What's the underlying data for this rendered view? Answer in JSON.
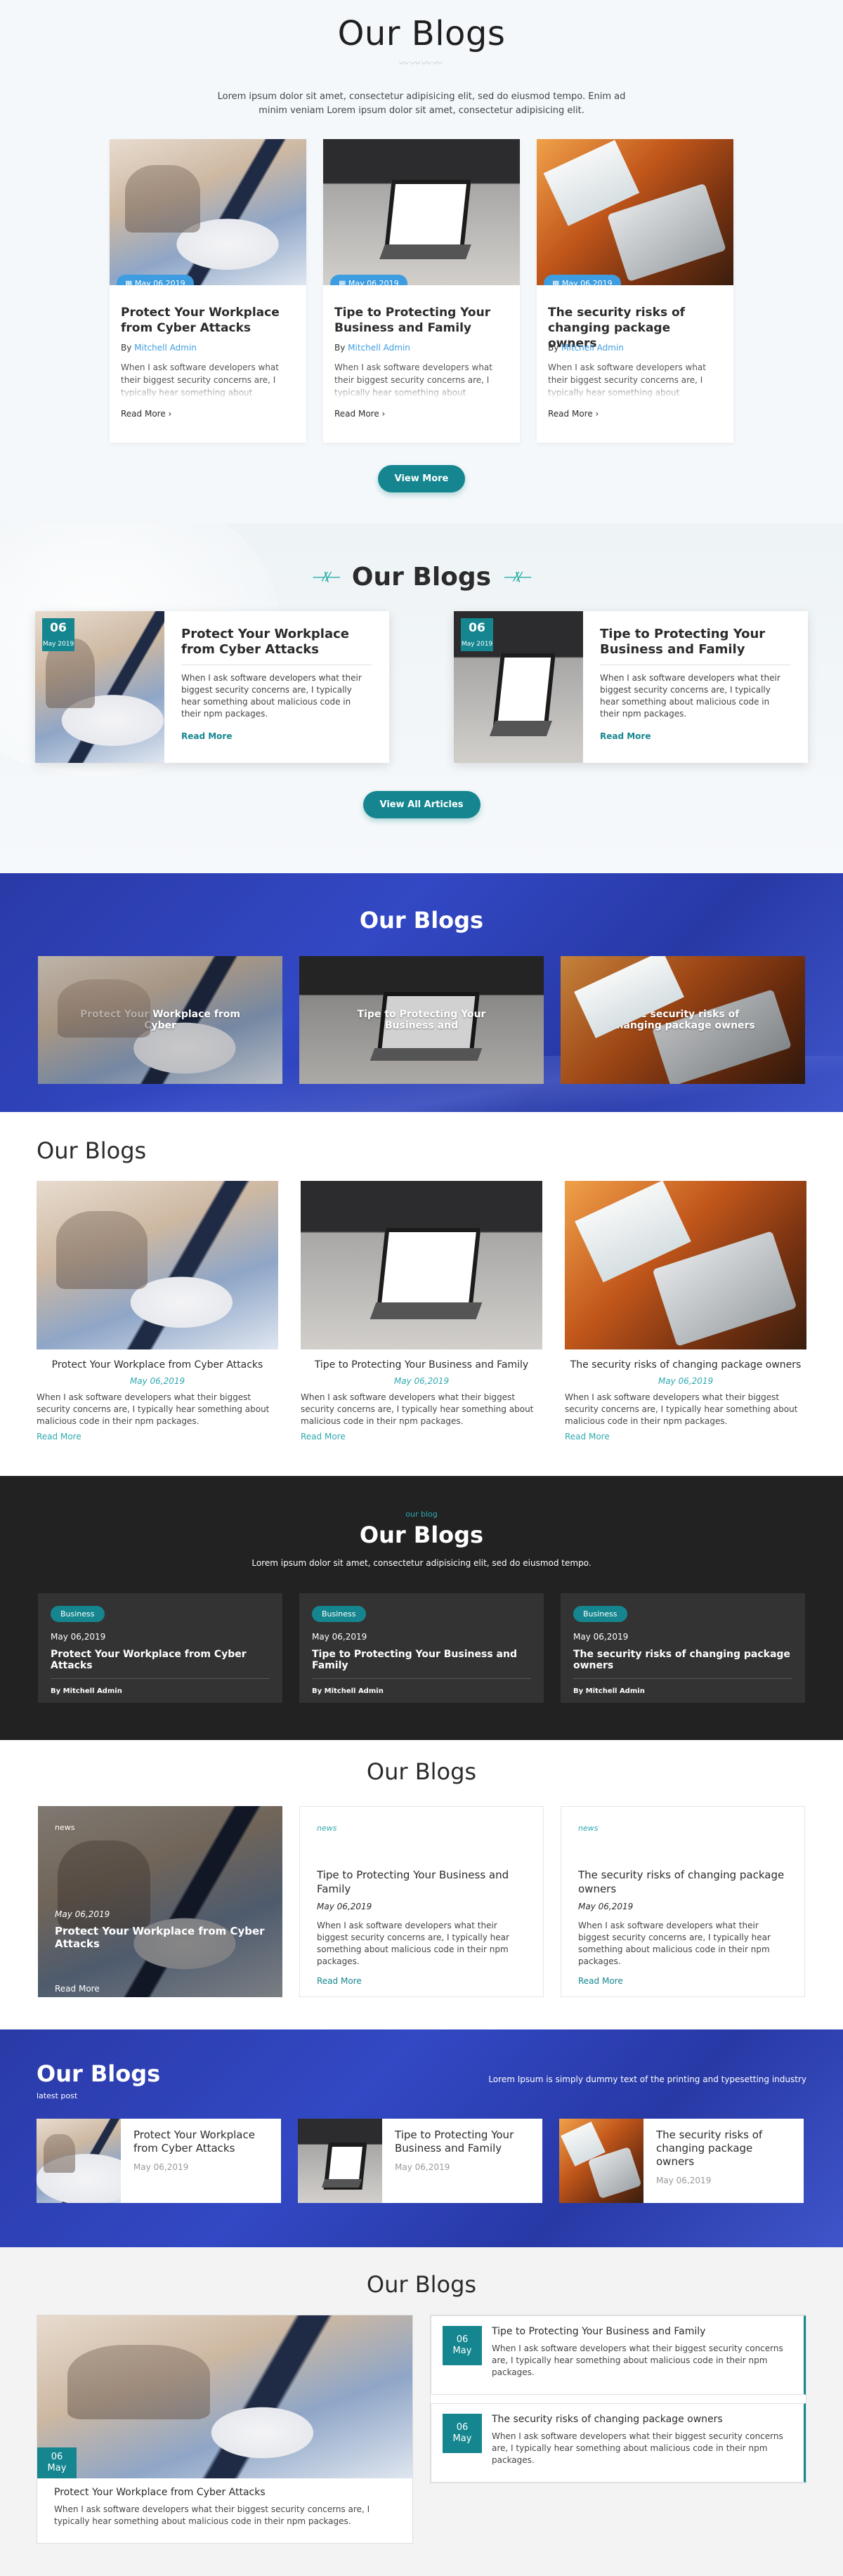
{
  "s1": {
    "title": "Our Blogs",
    "intro": "Lorem ipsum dolor sit amet, consectetur adipisicing elit, sed do eiusmod tempo. Enim ad minim veniam Lorem ipsum dolor sit amet, consectetur adipisicing elit.",
    "cards": [
      {
        "date": "May 06,2019",
        "title": "Protect Your Workplace from Cyber Attacks",
        "by": "By",
        "author": "Mitchell Admin",
        "excerpt": "When I ask software developers what their biggest security concerns are, I typically hear something about",
        "readmore": "Read More"
      },
      {
        "date": "May 06,2019",
        "title": "Tipe to Protecting Your Business and Family",
        "by": "By",
        "author": "Mitchell Admin",
        "excerpt": "When I ask software developers what their biggest security concerns are, I typically hear something about",
        "readmore": "Read More"
      },
      {
        "date": "May 06,2019",
        "title": "The security risks of changing package owners",
        "by": "By",
        "author": "Mitchell Admin",
        "excerpt": "When I ask software developers what their biggest security concerns are, I typically hear something about",
        "readmore": "Read More"
      }
    ],
    "button": "View More"
  },
  "s2": {
    "title": "Our Blogs",
    "cards": [
      {
        "day": "06",
        "month": "May 2019",
        "title": "Protect Your Workplace from Cyber Attacks",
        "excerpt": "When I ask software developers what their biggest security concerns are, I typically hear something about malicious code in their npm packages.",
        "readmore": "Read More"
      },
      {
        "day": "06",
        "month": "May 2019",
        "title": "Tipe to Protecting Your Business and Family",
        "excerpt": "When I ask software developers what their biggest security concerns are, I typically hear something about malicious code in their npm packages.",
        "readmore": "Read More"
      }
    ],
    "button": "View All Articles"
  },
  "s3": {
    "title": "Our Blogs",
    "tiles": [
      {
        "title": "Protect Your Workplace from Cyber"
      },
      {
        "title": "Tipe to Protecting Your Business and"
      },
      {
        "title": "The security risks of changing package owners"
      }
    ]
  },
  "s4": {
    "title": "Our Blogs",
    "cards": [
      {
        "title": "Protect Your Workplace from Cyber Attacks",
        "date": "May 06,2019",
        "excerpt": "When I ask software developers what their biggest security concerns are, I typically hear something about malicious code in their npm packages.",
        "readmore": "Read More"
      },
      {
        "title": "Tipe to Protecting Your Business and Family",
        "date": "May 06,2019",
        "excerpt": "When I ask software developers what their biggest security concerns are, I typically hear something about malicious code in their npm packages.",
        "readmore": "Read More"
      },
      {
        "title": "The security risks of changing package owners",
        "date": "May 06,2019",
        "excerpt": "When I ask software developers what their biggest security concerns are, I typically hear something about malicious code in their npm packages.",
        "readmore": "Read More"
      }
    ]
  },
  "s5": {
    "kicker": "our blog",
    "title": "Our Blogs",
    "intro": "Lorem ipsum dolor sit amet, consectetur adipisicing elit, sed do eiusmod tempo.",
    "cards": [
      {
        "tag": "Business",
        "date": "May 06,2019",
        "title": "Protect Your Workplace from Cyber Attacks",
        "by": "By Mitchell Admin"
      },
      {
        "tag": "Business",
        "date": "May 06,2019",
        "title": "Tipe to Protecting Your Business and Family",
        "by": "By Mitchell Admin"
      },
      {
        "tag": "Business",
        "date": "May 06,2019",
        "title": "The security risks of changing package owners",
        "by": "By Mitchell Admin"
      }
    ]
  },
  "s6": {
    "title": "Our Blogs",
    "featured": {
      "category": "news",
      "date": "May 06,2019",
      "title": "Protect Your Workplace from Cyber Attacks",
      "readmore": "Read More"
    },
    "cards": [
      {
        "category": "news",
        "title": "Tipe to Protecting Your Business and Family",
        "date": "May 06,2019",
        "excerpt": "When I ask software developers what their biggest security concerns are, I typically hear something about malicious code in their npm packages.",
        "readmore": "Read More"
      },
      {
        "category": "news",
        "title": "The security risks of changing package owners",
        "date": "May 06,2019",
        "excerpt": "When I ask software developers what their biggest security concerns are, I typically hear something about malicious code in their npm packages.",
        "readmore": "Read More"
      }
    ]
  },
  "s7": {
    "title": "Our Blogs",
    "subtitle": "latest post",
    "right_text": "Lorem Ipsum is simply dummy text of the printing and typesetting industry",
    "cards": [
      {
        "title": "Protect Your Workplace from Cyber Attacks",
        "date": "May 06,2019"
      },
      {
        "title": "Tipe to Protecting Your Business and Family",
        "date": "May 06,2019"
      },
      {
        "title": "The security risks of changing package owners",
        "date": "May 06,2019"
      }
    ]
  },
  "s8": {
    "title": "Our Blogs",
    "big": {
      "day": "06",
      "month": "May",
      "title": "Protect Your Workplace from Cyber Attacks",
      "excerpt": "When I ask software developers what their biggest security concerns are, I typically hear something about malicious code in their npm packages."
    },
    "items": [
      {
        "day": "06",
        "month": "May",
        "title": "Tipe to Protecting Your Business and Family",
        "excerpt": "When I ask software developers what their biggest security concerns are, I typically hear something about malicious code in their npm packages."
      },
      {
        "day": "06",
        "month": "May",
        "title": "The security risks of changing package owners",
        "excerpt": "When I ask software developers what their biggest security concerns are, I typically hear something about malicious code in their npm packages."
      }
    ]
  },
  "colors": {
    "teal": "#15868f",
    "blue_accent": "#3d9de0",
    "royal_blue": "#3248c4",
    "dark": "#222222"
  }
}
